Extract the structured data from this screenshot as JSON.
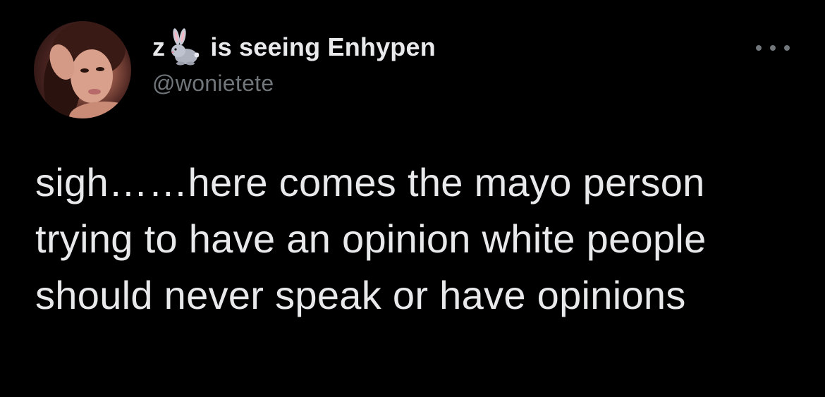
{
  "tweet": {
    "avatar_icon": "user-avatar",
    "name_prefix": "z",
    "name_emoji_icon": "rabbit-emoji-icon",
    "name_suffix": " is seeing Enhypen",
    "handle": "@wonietete",
    "more_icon": "more-options-icon",
    "text": "sigh……here comes the mayo person trying to have an opinion white people should never speak or have opinions"
  },
  "colors": {
    "background": "#000000",
    "primary_text": "#e7e9ea",
    "secondary_text": "#71767b"
  }
}
